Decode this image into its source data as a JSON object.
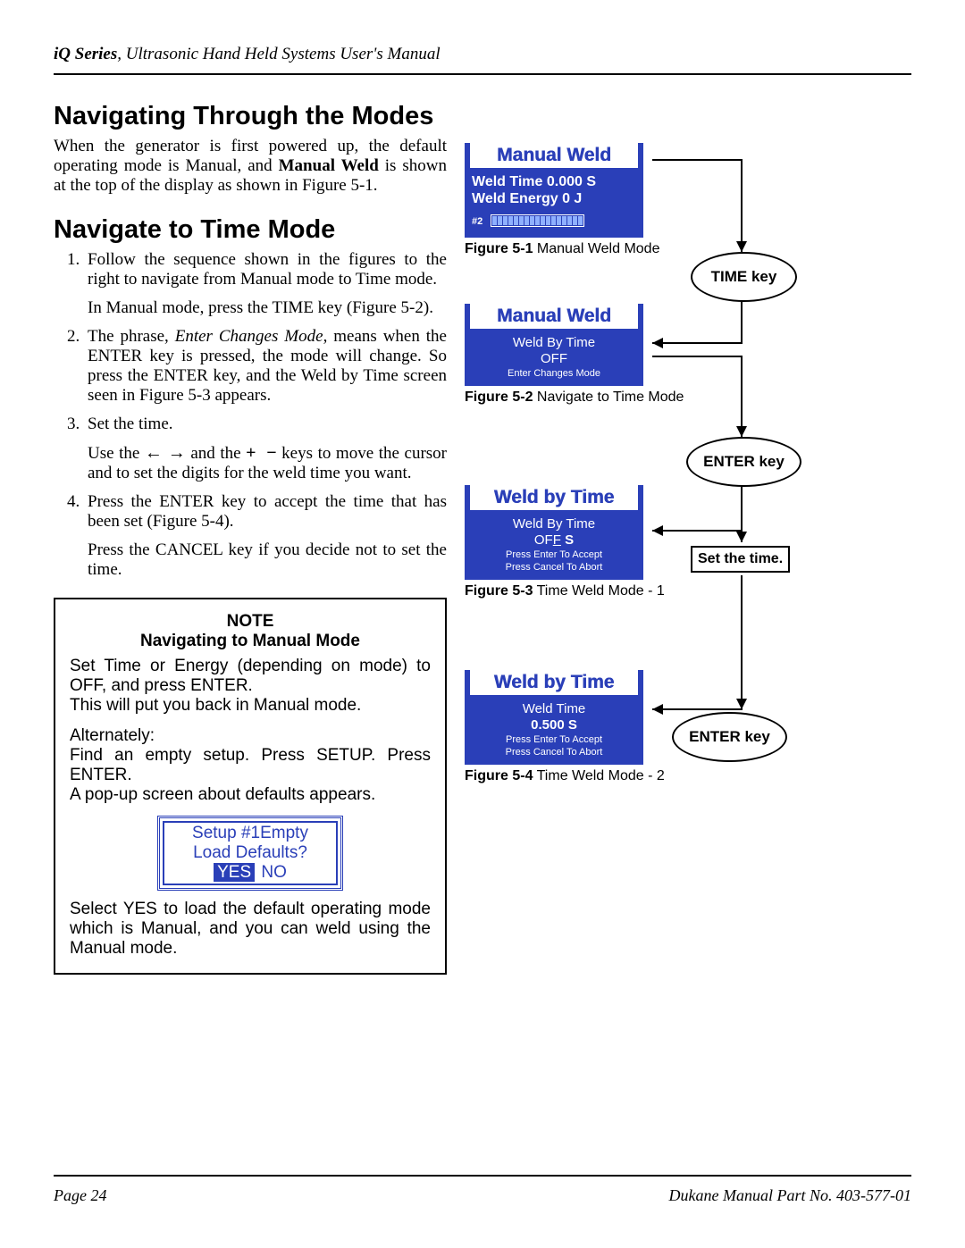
{
  "header": {
    "series": "iQ Series",
    "subtitle": ", Ultrasonic Hand Held Systems User's Manual"
  },
  "left": {
    "h1": "Navigating Through the Modes",
    "intro_a": "When the generator is first powered up, the default operating mode is Manual, and ",
    "intro_bold": "Manual Weld",
    "intro_b": " is shown at the top of the display as shown in Figure 5-1.",
    "h2": "Navigate to Time Mode",
    "step1a": "Follow the sequence shown in the figures to the right to navigate from Manual mode to Time mode.",
    "step1b": "In Manual mode,  press the TIME key (Figure 5-2).",
    "step2a": "The phrase, ",
    "step2i": "Enter Changes Mode",
    "step2b": ", means when the ENTER key is pressed, the mode will change. So press the ENTER key, and the Weld by Time screen seen in Figure 5-3 appears.",
    "step3a": "Set the time.",
    "step3b_a": "Use the ",
    "step3b_b": " and the ",
    "step3b_c": " keys to move the cursor and to set the digits for the weld time you want.",
    "step4a": "Press the ENTER key to accept the time that has been set (Figure 5-4).",
    "step4b": "Press the CANCEL key if you decide not to set the time."
  },
  "note": {
    "title": "NOTE",
    "subtitle": "Navigating to Manual Mode",
    "p1": "Set Time or Energy (depending on mode) to OFF, and press ENTER.",
    "p2": "This will put you back in Manual mode.",
    "p3": "Alternately:",
    "p4": "Find an empty setup. Press SETUP. Press ENTER.",
    "p5": "A pop-up screen about defaults appears.",
    "popup_l1": "Setup #1Empty",
    "popup_l2": "Load Defaults?",
    "popup_yes": "YES",
    "popup_no": "NO",
    "p6": "Select YES to load the default operating mode which is Manual, and you can weld using the Manual mode."
  },
  "right": {
    "fig1": {
      "title": "Manual Weld",
      "l1": "Weld Time 0.000 S",
      "l2": "Weld Energy 0 J",
      "hash": "#2",
      "caption_b": "Figure 5-1",
      "caption": " Manual Weld Mode"
    },
    "key_time": "TIME key",
    "fig2": {
      "title": "Manual Weld",
      "l1": "Weld By Time",
      "l2": "OFF",
      "l3": "Enter Changes Mode",
      "caption_b": "Figure 5-2",
      "caption": " Navigate to Time Mode"
    },
    "key_enter1": "ENTER key",
    "fig3": {
      "title": "Weld by Time",
      "l1": "Weld By Time",
      "l2a": "OF",
      "l2u": "F",
      "l2b": "   S",
      "s1": "Press  Enter  To  Accept",
      "s2": "Press  Cancel  To  Abort",
      "caption_b": "Figure 5-3",
      "caption": " Time Weld Mode - 1"
    },
    "set_time": "Set the time.",
    "fig4": {
      "title": "Weld by Time",
      "l1": "Weld Time",
      "l2": "0.500   S",
      "s1": "Press  Enter  To  Accept",
      "s2": "Press  Cancel  To  Abort",
      "caption_b": "Figure 5-4",
      "caption": " Time Weld Mode - 2"
    },
    "key_enter2": "ENTER key"
  },
  "footer": {
    "left": "Page   24",
    "right": "Dukane Manual Part No.  403-577-01"
  }
}
